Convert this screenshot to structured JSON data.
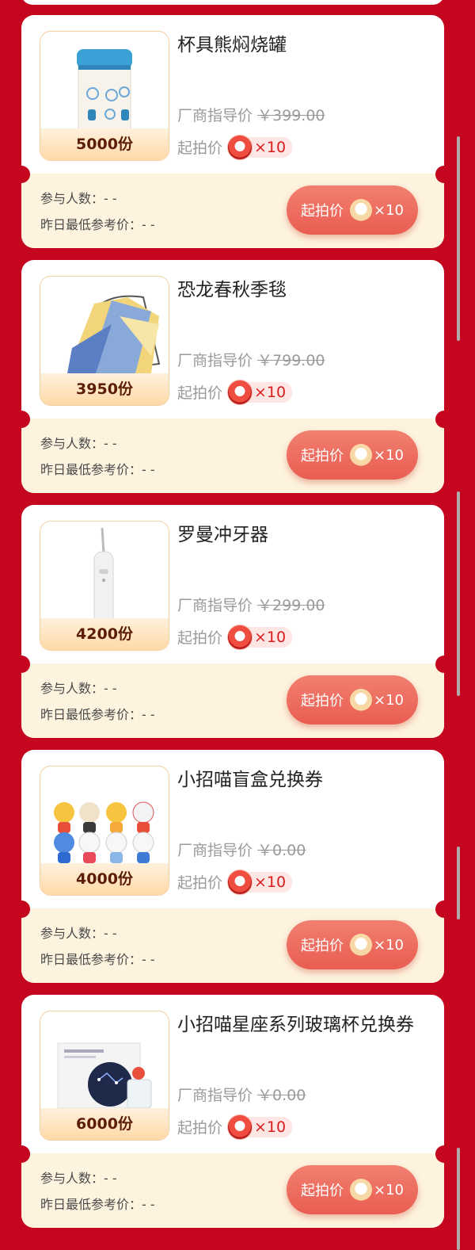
{
  "labels": {
    "msrp": "厂商指导价",
    "start_price": "起拍价",
    "participants": "参与人数：- -",
    "yesterday_low": "昨日最低参考价：- -",
    "bid_button": "起拍价",
    "coin_multiplier": "×10"
  },
  "products": [
    {
      "name": "杯具熊焖烧罐",
      "quantity": "5000份",
      "msrp": "￥399.00",
      "image_icon": "thermos-jar-image"
    },
    {
      "name": "恐龙春秋季毯",
      "quantity": "3950份",
      "msrp": "￥799.00",
      "image_icon": "blanket-chair-image"
    },
    {
      "name": "罗曼冲牙器",
      "quantity": "4200份",
      "msrp": "￥299.00",
      "image_icon": "water-flosser-image"
    },
    {
      "name": "小招喵盲盒兑换券",
      "quantity": "4000份",
      "msrp": "￥0.00",
      "image_icon": "blind-box-figures-image"
    },
    {
      "name": "小招喵星座系列玻璃杯兑换券",
      "quantity": "6000份",
      "msrp": "￥0.00",
      "image_icon": "constellation-glass-cup-image"
    }
  ],
  "colors": {
    "background": "#c4061f",
    "button": "#ea5d52",
    "card_bottom": "#fdf3de"
  }
}
